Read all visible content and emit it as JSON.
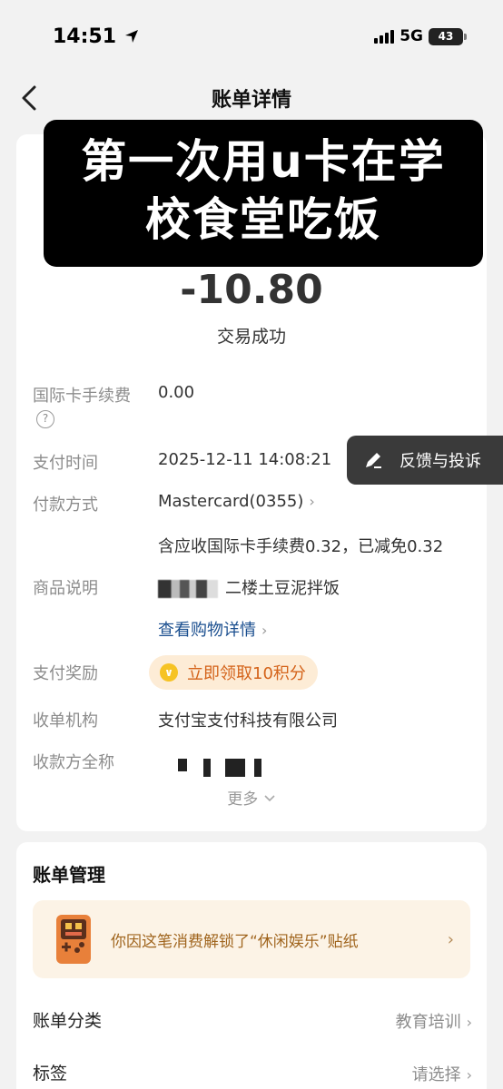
{
  "status_bar": {
    "time": "14:51",
    "network": "5G",
    "battery": "43"
  },
  "nav": {
    "title": "账单详情"
  },
  "overlay": {
    "line1": "第一次用u卡在学",
    "line2": "校食堂吃饭"
  },
  "bill": {
    "amount": "-10.80",
    "status": "交易成功",
    "fee_label": "国际卡手续费",
    "fee_value": "0.00",
    "time_label": "支付时间",
    "time_value": "2025-12-11 14:08:21",
    "method_label": "付款方式",
    "method_value": "Mastercard(0355)",
    "fee_note": "含应收国际卡手续费0.32，已减免0.32",
    "desc_label": "商品说明",
    "desc_value": "二楼土豆泥拌饭",
    "purchase_link": "查看购物详情",
    "reward_label": "支付奖励",
    "reward_text": "立即领取10积分",
    "merchant_label": "收单机构",
    "merchant_value": "支付宝支付科技有限公司",
    "payee_label": "收款方全称",
    "more": "更多"
  },
  "feedback": {
    "label": "反馈与投诉"
  },
  "manage": {
    "title": "账单管理",
    "sticker_text": "你因这笔消费解锁了“休闲娱乐”贴纸",
    "category_label": "账单分类",
    "category_value": "教育培训",
    "tag_label": "标签",
    "tag_value": "请选择"
  },
  "colors": {
    "link": "#1b4f8f",
    "reward": "#d4631a",
    "banner": "#fcf3e6"
  }
}
